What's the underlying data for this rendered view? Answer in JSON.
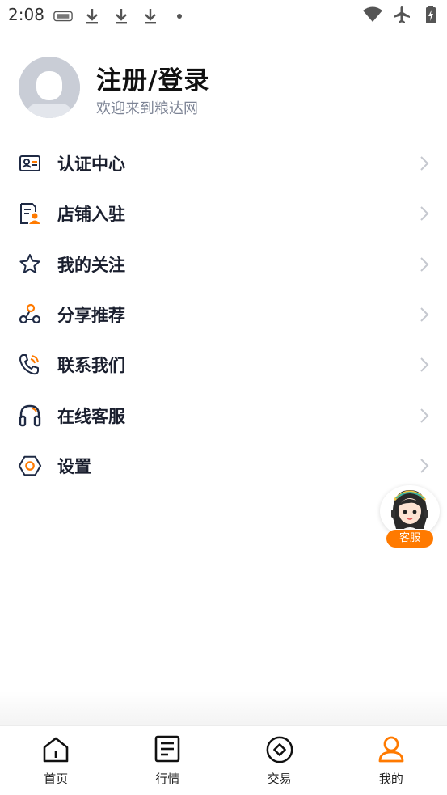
{
  "status_bar": {
    "time": "2:08",
    "left_icons": [
      "app-notification-icon",
      "download-icon",
      "download-icon",
      "download-icon",
      "dot-icon"
    ],
    "right_icons": [
      "wifi-icon",
      "airplane-mode-icon",
      "battery-charging-icon"
    ]
  },
  "profile": {
    "title": "注册/登录",
    "subtitle": "欢迎来到粮达网"
  },
  "menu": {
    "items": [
      {
        "label": "认证中心",
        "icon": "id-card-icon"
      },
      {
        "label": "店铺入驻",
        "icon": "store-document-icon"
      },
      {
        "label": "我的关注",
        "icon": "star-icon"
      },
      {
        "label": "分享推荐",
        "icon": "share-icon"
      },
      {
        "label": "联系我们",
        "icon": "phone-icon"
      },
      {
        "label": "在线客服",
        "icon": "headset-icon"
      },
      {
        "label": "设置",
        "icon": "settings-icon"
      }
    ]
  },
  "floating_service": {
    "badge": "客服"
  },
  "tabbar": {
    "tabs": [
      {
        "label": "首页",
        "icon": "home-icon"
      },
      {
        "label": "行情",
        "icon": "market-document-icon"
      },
      {
        "label": "交易",
        "icon": "trade-icon"
      },
      {
        "label": "我的",
        "icon": "profile-icon",
        "active": true
      }
    ]
  },
  "colors": {
    "accent": "#ff7a00",
    "icon_dark": "#1f2a44",
    "text_secondary": "#7e8596",
    "divider": "#e6e8ec"
  }
}
